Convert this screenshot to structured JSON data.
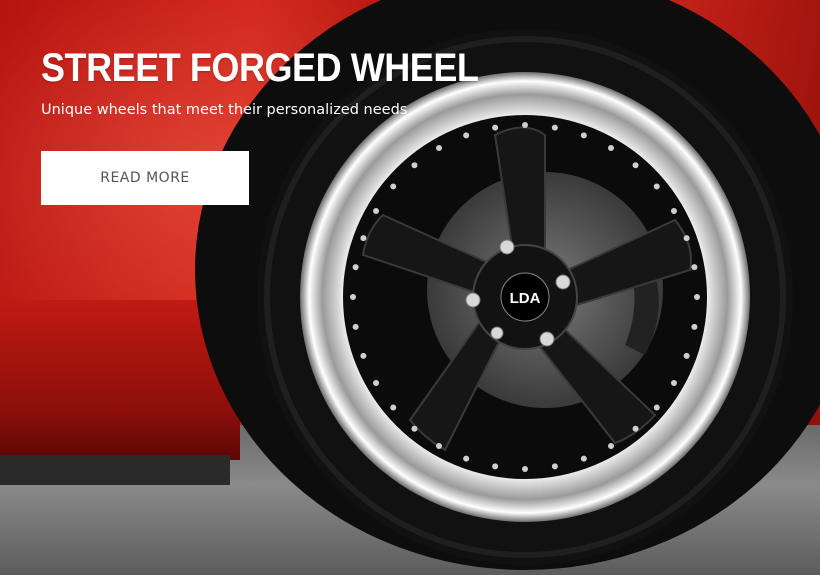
{
  "hero": {
    "title": "STREET FORGED WHEEL",
    "subtitle": "Unique wheels that meet their personalized needs",
    "cta_label": "READ MORE",
    "wheel_logo": "LDA"
  },
  "colors": {
    "car_body": "#c61f16",
    "button_bg": "#ffffff",
    "button_text": "#555555",
    "title_text": "#ffffff"
  }
}
